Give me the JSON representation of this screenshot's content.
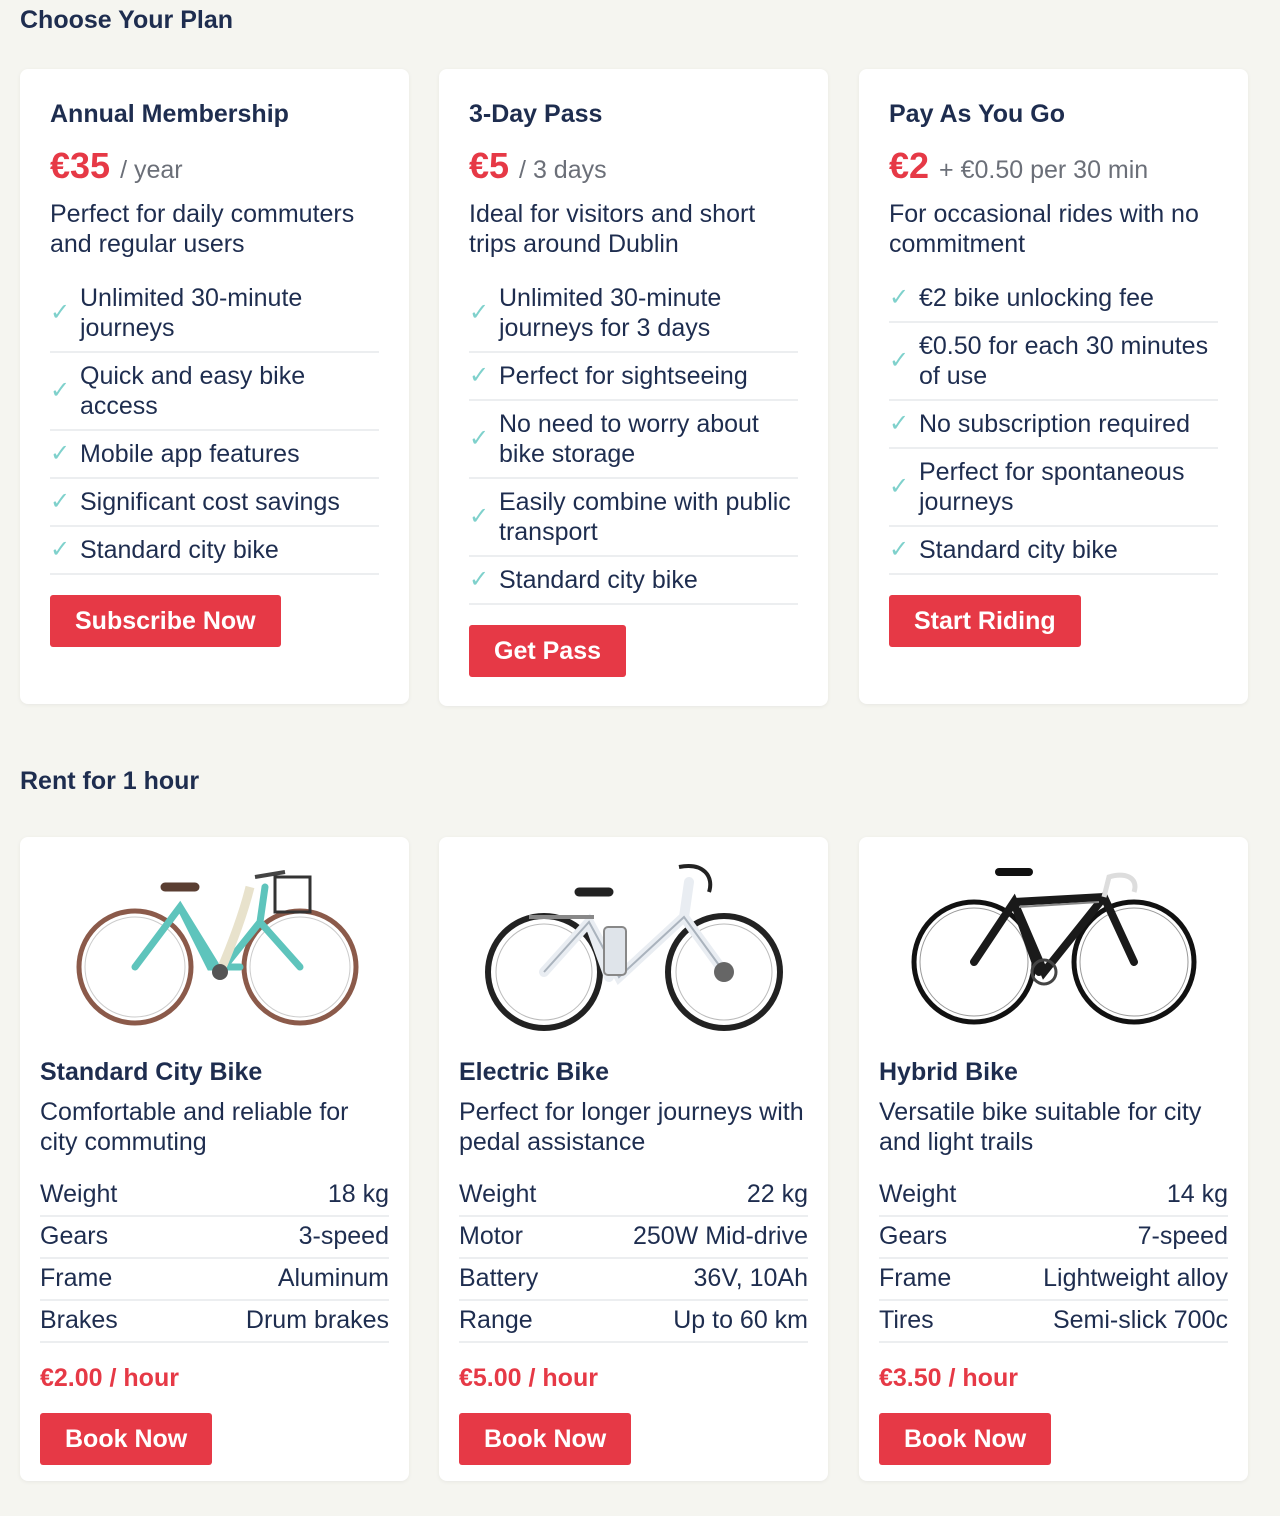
{
  "plans_section": {
    "title": "Choose Your Plan"
  },
  "plans": [
    {
      "name": "Annual Membership",
      "price": "€35",
      "period": "/ year",
      "description": "Perfect for daily commuters and regular users",
      "features": [
        "Unlimited 30-minute journeys",
        "Quick and easy bike access",
        "Mobile app features",
        "Significant cost savings",
        "Standard city bike"
      ],
      "button": "Subscribe Now"
    },
    {
      "name": "3-Day Pass",
      "price": "€5",
      "period": "/ 3 days",
      "description": "Ideal for visitors and short trips around Dublin",
      "features": [
        "Unlimited 30-minute journeys for 3 days",
        "Perfect for sightseeing",
        "No need to worry about bike storage",
        "Easily combine with public transport",
        "Standard city bike"
      ],
      "button": "Get Pass"
    },
    {
      "name": "Pay As You Go",
      "price": "€2",
      "period": "+ €0.50 per 30 min",
      "description": "For occasional rides with no commitment",
      "features": [
        "€2 bike unlocking fee",
        "€0.50 for each 30 minutes of use",
        "No subscription required",
        "Perfect for spontaneous journeys",
        "Standard city bike"
      ],
      "button": "Start Riding"
    }
  ],
  "rent_section": {
    "title": "Rent for 1 hour"
  },
  "bikes": [
    {
      "name": "Standard City Bike",
      "image_icon": "city-bike-icon",
      "description": "Comfortable and reliable for city commuting",
      "specs": [
        {
          "label": "Weight",
          "value": "18 kg"
        },
        {
          "label": "Gears",
          "value": "3-speed"
        },
        {
          "label": "Frame",
          "value": "Aluminum"
        },
        {
          "label": "Brakes",
          "value": "Drum brakes"
        }
      ],
      "price": "€2.00 / hour",
      "button": "Book Now"
    },
    {
      "name": "Electric Bike",
      "image_icon": "electric-bike-icon",
      "description": "Perfect for longer journeys with pedal assistance",
      "specs": [
        {
          "label": "Weight",
          "value": "22 kg"
        },
        {
          "label": "Motor",
          "value": "250W Mid-drive"
        },
        {
          "label": "Battery",
          "value": "36V, 10Ah"
        },
        {
          "label": "Range",
          "value": "Up to 60 km"
        }
      ],
      "price": "€5.00 / hour",
      "button": "Book Now"
    },
    {
      "name": "Hybrid Bike",
      "image_icon": "hybrid-bike-icon",
      "description": "Versatile bike suitable for city and light trails",
      "specs": [
        {
          "label": "Weight",
          "value": "14 kg"
        },
        {
          "label": "Gears",
          "value": "7-speed"
        },
        {
          "label": "Frame",
          "value": "Lightweight alloy"
        },
        {
          "label": "Tires",
          "value": "Semi-slick 700c"
        }
      ],
      "price": "€3.50 / hour",
      "button": "Book Now"
    }
  ],
  "colors": {
    "accent": "#e63946",
    "heading": "#1e2d4f",
    "check": "#7fd1cc",
    "background": "#f5f5f0"
  }
}
